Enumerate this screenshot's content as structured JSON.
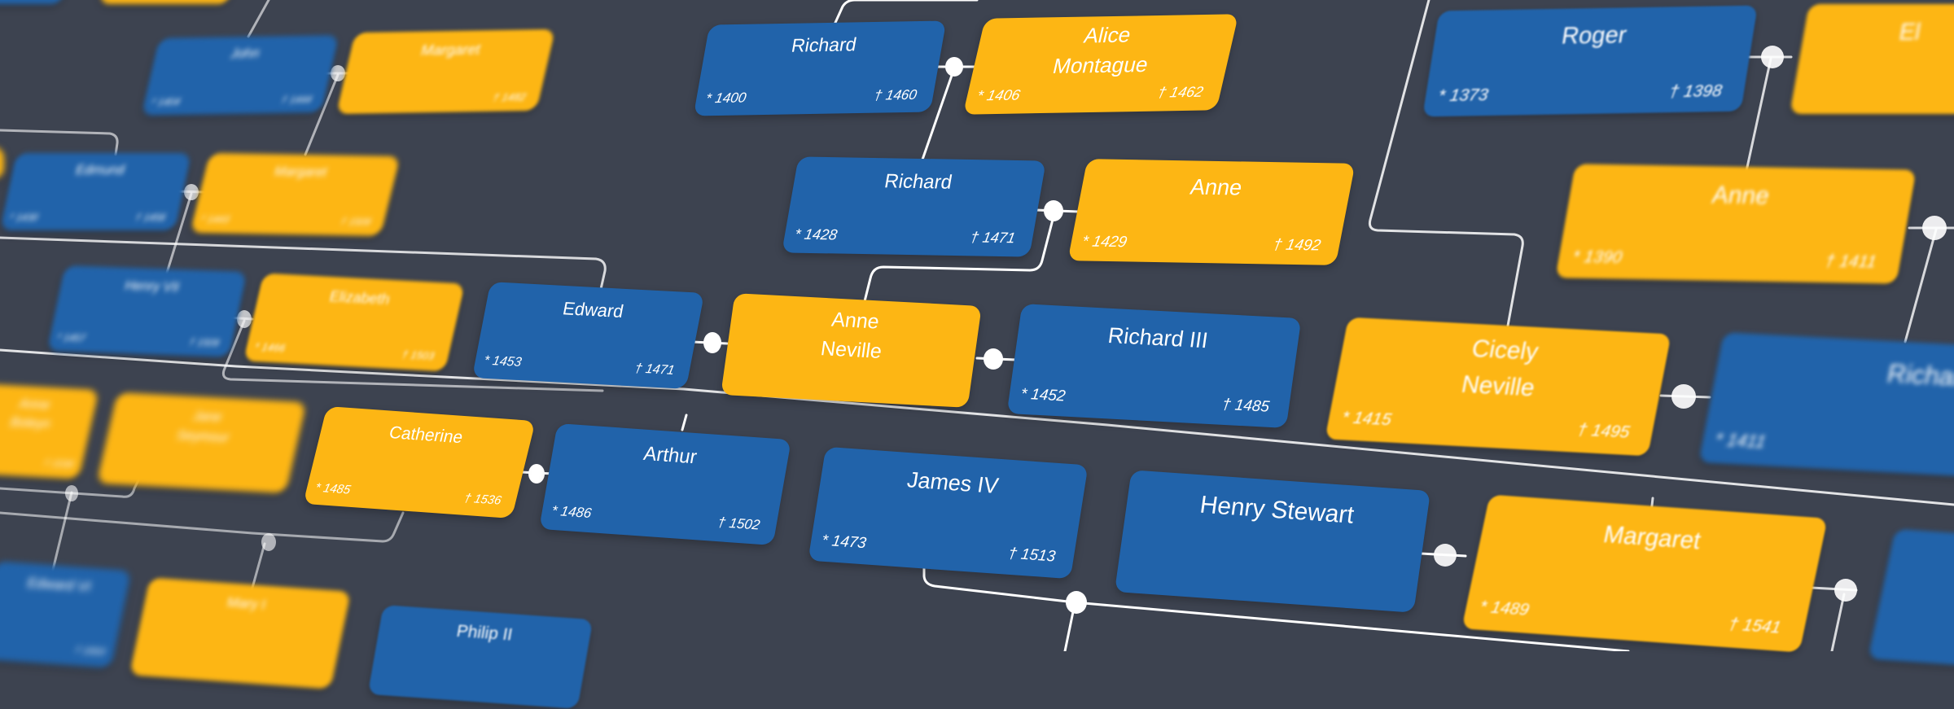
{
  "colors": {
    "background": "#3d4350",
    "male": "#2163aa",
    "female": "#fdb614",
    "link": "#ffffff"
  },
  "legend": {
    "born_symbol": "*",
    "died_symbol": "†"
  },
  "nodes": [
    {
      "id": "richard-1400",
      "name": "Richard",
      "gender": "male",
      "born": "* 1400",
      "died": "† 1460"
    },
    {
      "id": "alice-montague",
      "name": "Alice\nMontague",
      "gender": "female",
      "born": "* 1406",
      "died": "† 1462"
    },
    {
      "id": "richard-1428",
      "name": "Richard",
      "gender": "male",
      "born": "* 1428",
      "died": "† 1471"
    },
    {
      "id": "anne-1429",
      "name": "Anne",
      "gender": "female",
      "born": "* 1429",
      "died": "† 1492"
    },
    {
      "id": "edward-1453",
      "name": "Edward",
      "gender": "male",
      "born": "* 1453",
      "died": "† 1471"
    },
    {
      "id": "anne-neville",
      "name": "Anne\nNeville",
      "gender": "female",
      "born": "",
      "died": ""
    },
    {
      "id": "richard-iii",
      "name": "Richard III",
      "gender": "male",
      "born": "* 1452",
      "died": "† 1485"
    },
    {
      "id": "arthur",
      "name": "Arthur",
      "gender": "male",
      "born": "* 1486",
      "died": "† 1502"
    },
    {
      "id": "james-iv",
      "name": "James IV",
      "gender": "male",
      "born": "* 1473",
      "died": "† 1513"
    },
    {
      "id": "henry-stewart",
      "name": "Henry Stewart",
      "gender": "male",
      "born": "",
      "died": ""
    },
    {
      "id": "margaret-1489",
      "name": "Margaret",
      "gender": "female",
      "born": "* 1489",
      "died": "† 1541"
    },
    {
      "id": "catherine",
      "name": "Catherine",
      "gender": "female",
      "born": "* 1485",
      "died": "† 1536"
    },
    {
      "id": "roger",
      "name": "Roger",
      "gender": "male",
      "born": "* 1373",
      "died": "† 1398"
    },
    {
      "id": "eleanor",
      "name": "El",
      "gender": "female",
      "born": "",
      "died": ""
    },
    {
      "id": "anne-1390",
      "name": "Anne",
      "gender": "female",
      "born": "* 1390",
      "died": "† 1411"
    },
    {
      "id": "cicely-neville",
      "name": "Cicely\nNeville",
      "gender": "female",
      "born": "* 1415",
      "died": "† 1495"
    },
    {
      "id": "richard-1411",
      "name": "Richard",
      "gender": "male",
      "born": "* 1411",
      "died": ""
    },
    {
      "id": "john",
      "name": "John",
      "gender": "male",
      "born": "* 1404",
      "died": "† 1444"
    },
    {
      "id": "margaret-1482",
      "name": "Margaret",
      "gender": "female",
      "born": "",
      "died": "† 1482"
    },
    {
      "id": "edmund",
      "name": "Edmund",
      "gender": "male",
      "born": "* 1430",
      "died": "† 1456"
    },
    {
      "id": "margaret-1509",
      "name": "Margaret",
      "gender": "female",
      "born": "* 1443",
      "died": "† 1509"
    },
    {
      "id": "henry-vii",
      "name": "Henry VII",
      "gender": "male",
      "born": "* 1457",
      "died": "† 1509"
    },
    {
      "id": "elizabeth",
      "name": "Elizabeth",
      "gender": "female",
      "born": "* 1466",
      "died": "† 1503"
    },
    {
      "id": "anne-boleyn",
      "name": "Anne\nBoleyn",
      "gender": "female",
      "born": "",
      "died": "† 1536"
    },
    {
      "id": "jane-seymour",
      "name": "Jane\nSeymour",
      "gender": "female",
      "born": "",
      "died": ""
    },
    {
      "id": "edward-vi",
      "name": "Edward VI",
      "gender": "male",
      "born": "",
      "died": "† 1553"
    },
    {
      "id": "mary-i",
      "name": "Mary I",
      "gender": "female",
      "born": "",
      "died": ""
    },
    {
      "id": "philip-ii",
      "name": "Philip II",
      "gender": "male",
      "born": "",
      "died": ""
    }
  ]
}
